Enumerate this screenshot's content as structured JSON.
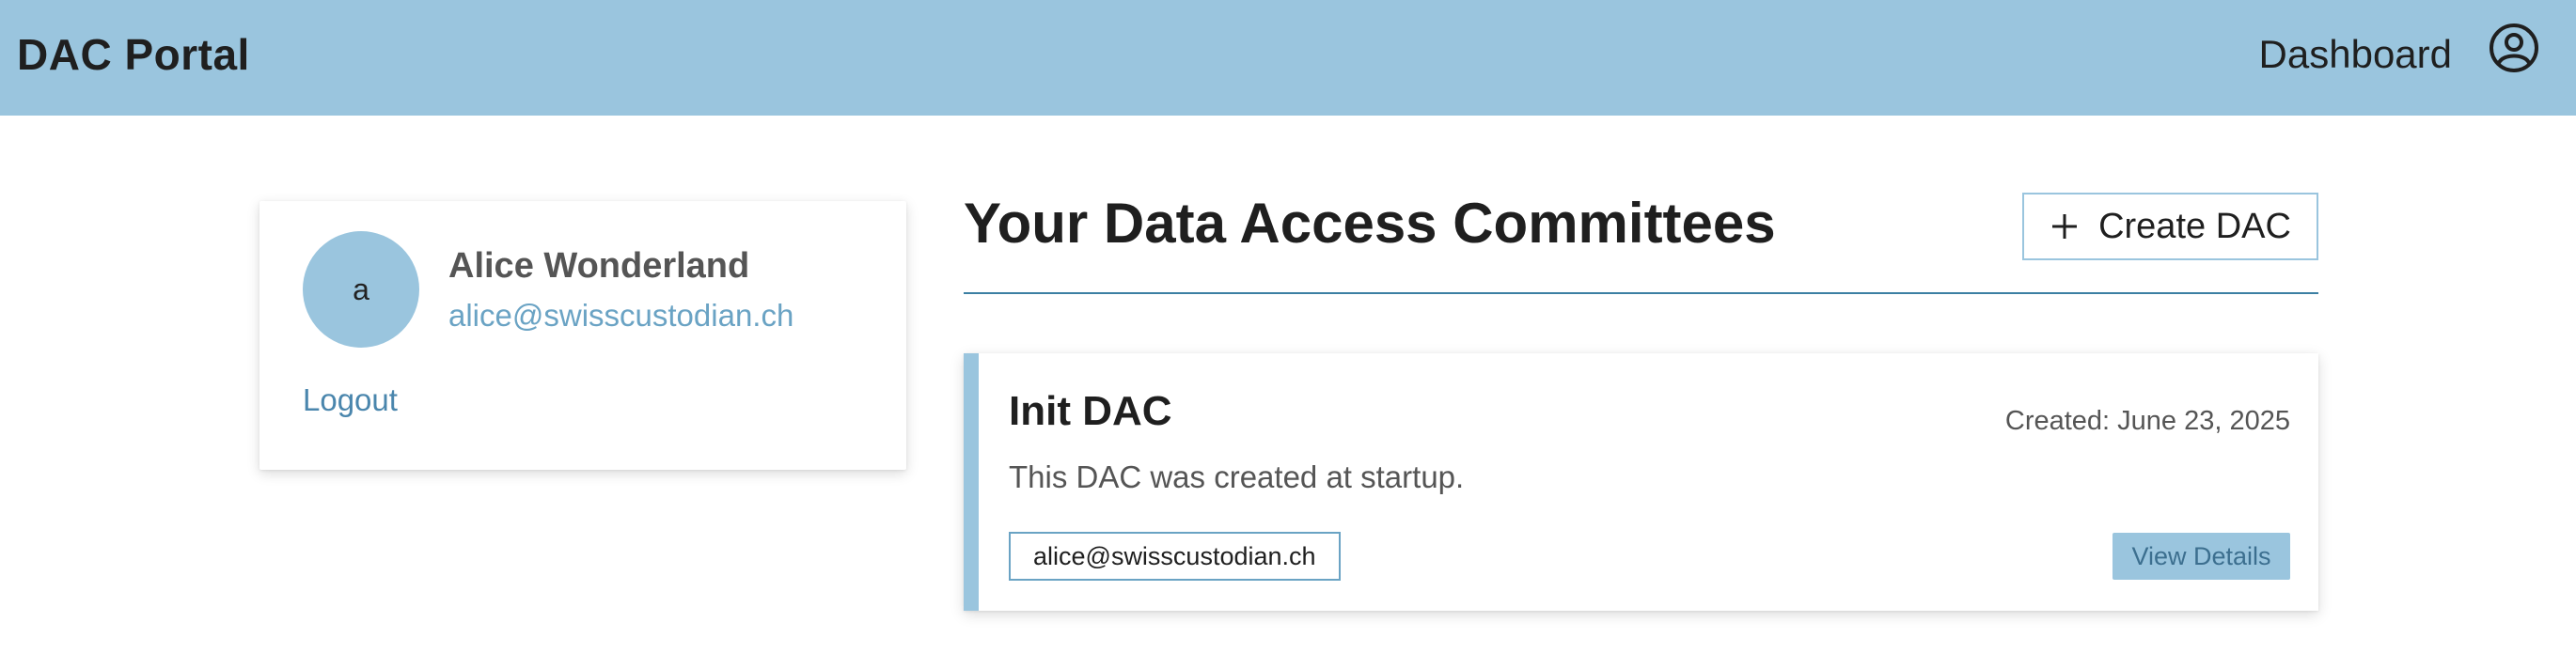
{
  "header": {
    "brand": "DAC Portal",
    "nav_dashboard": "Dashboard",
    "user_icon": "user-circle-icon",
    "background": "#9ac5de"
  },
  "profile": {
    "avatar_letter": "a",
    "name": "Alice Wonderland",
    "email": "alice@swisscustodian.ch",
    "logout_label": "Logout"
  },
  "main": {
    "section_title": "Your Data Access Committees",
    "create_button_label": "Create DAC",
    "create_button_icon": "plus-icon",
    "dacs": [
      {
        "title": "Init DAC",
        "created": "Created: June 23, 2025",
        "description": "This DAC was created at startup.",
        "members": [
          "alice@swisscustodian.ch"
        ],
        "view_label": "View Details"
      }
    ]
  },
  "colors": {
    "accent": "#9ac5de",
    "link": "#4a86ad",
    "rule": "#3c7fa3"
  }
}
